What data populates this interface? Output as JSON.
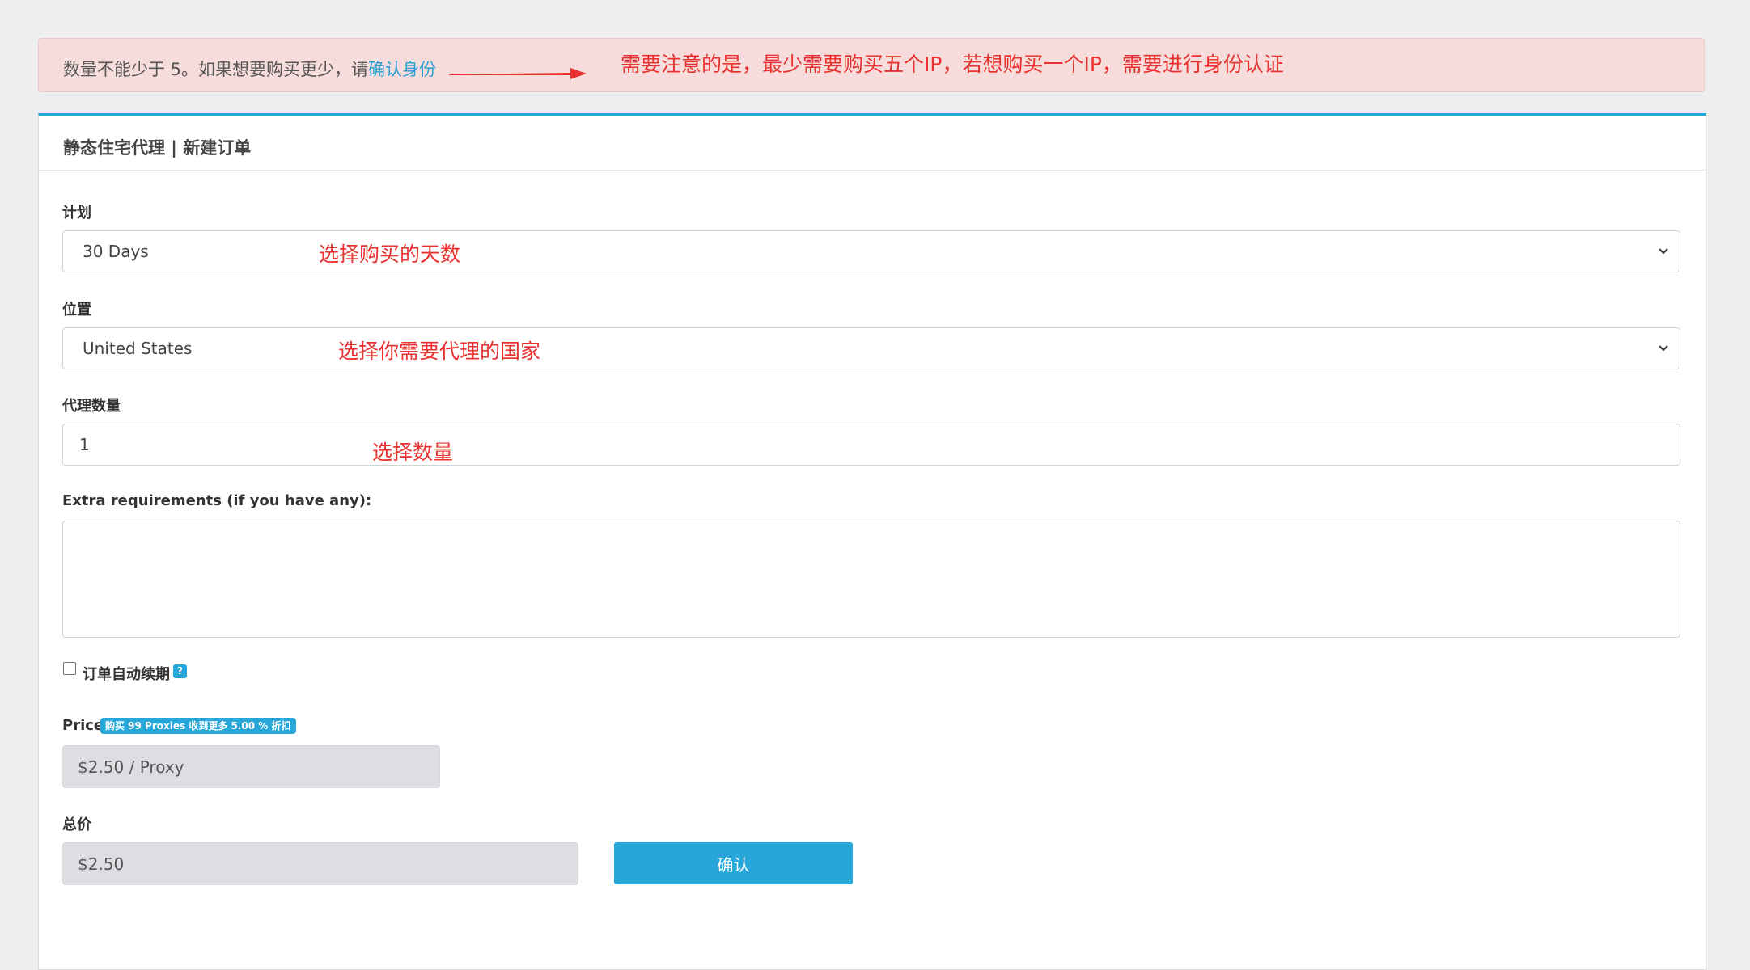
{
  "alert": {
    "text": "数量不能少于 5。如果想要购买更少，请",
    "link": "确认身份",
    "annotation": "需要注意的是，最少需要购买五个IP，若想购买一个IP，需要进行身份认证"
  },
  "panel": {
    "title": "静态住宅代理 | 新建订单"
  },
  "plan": {
    "label": "计划",
    "value": "30 Days",
    "annotation": "选择购买的天数"
  },
  "location": {
    "label": "位置",
    "value": "United States",
    "annotation": "选择你需要代理的国家"
  },
  "quantity": {
    "label": "代理数量",
    "value": "1",
    "annotation": "选择数量"
  },
  "extra": {
    "label": "Extra requirements (if you have any):",
    "value": ""
  },
  "auto_renew": {
    "label": "订单自动续期",
    "help": "?",
    "checked": false
  },
  "price": {
    "label": "Price",
    "badge": "购买 99 Proxies 收到更多 5.00 % 折扣",
    "value": "$2.50 / Proxy"
  },
  "total": {
    "label": "总价",
    "value": "$2.50",
    "confirm_label": "确认"
  },
  "colors": {
    "accent": "#26a6d9",
    "annotation": "#e8322f",
    "alert_bg": "#f7dcdc"
  }
}
